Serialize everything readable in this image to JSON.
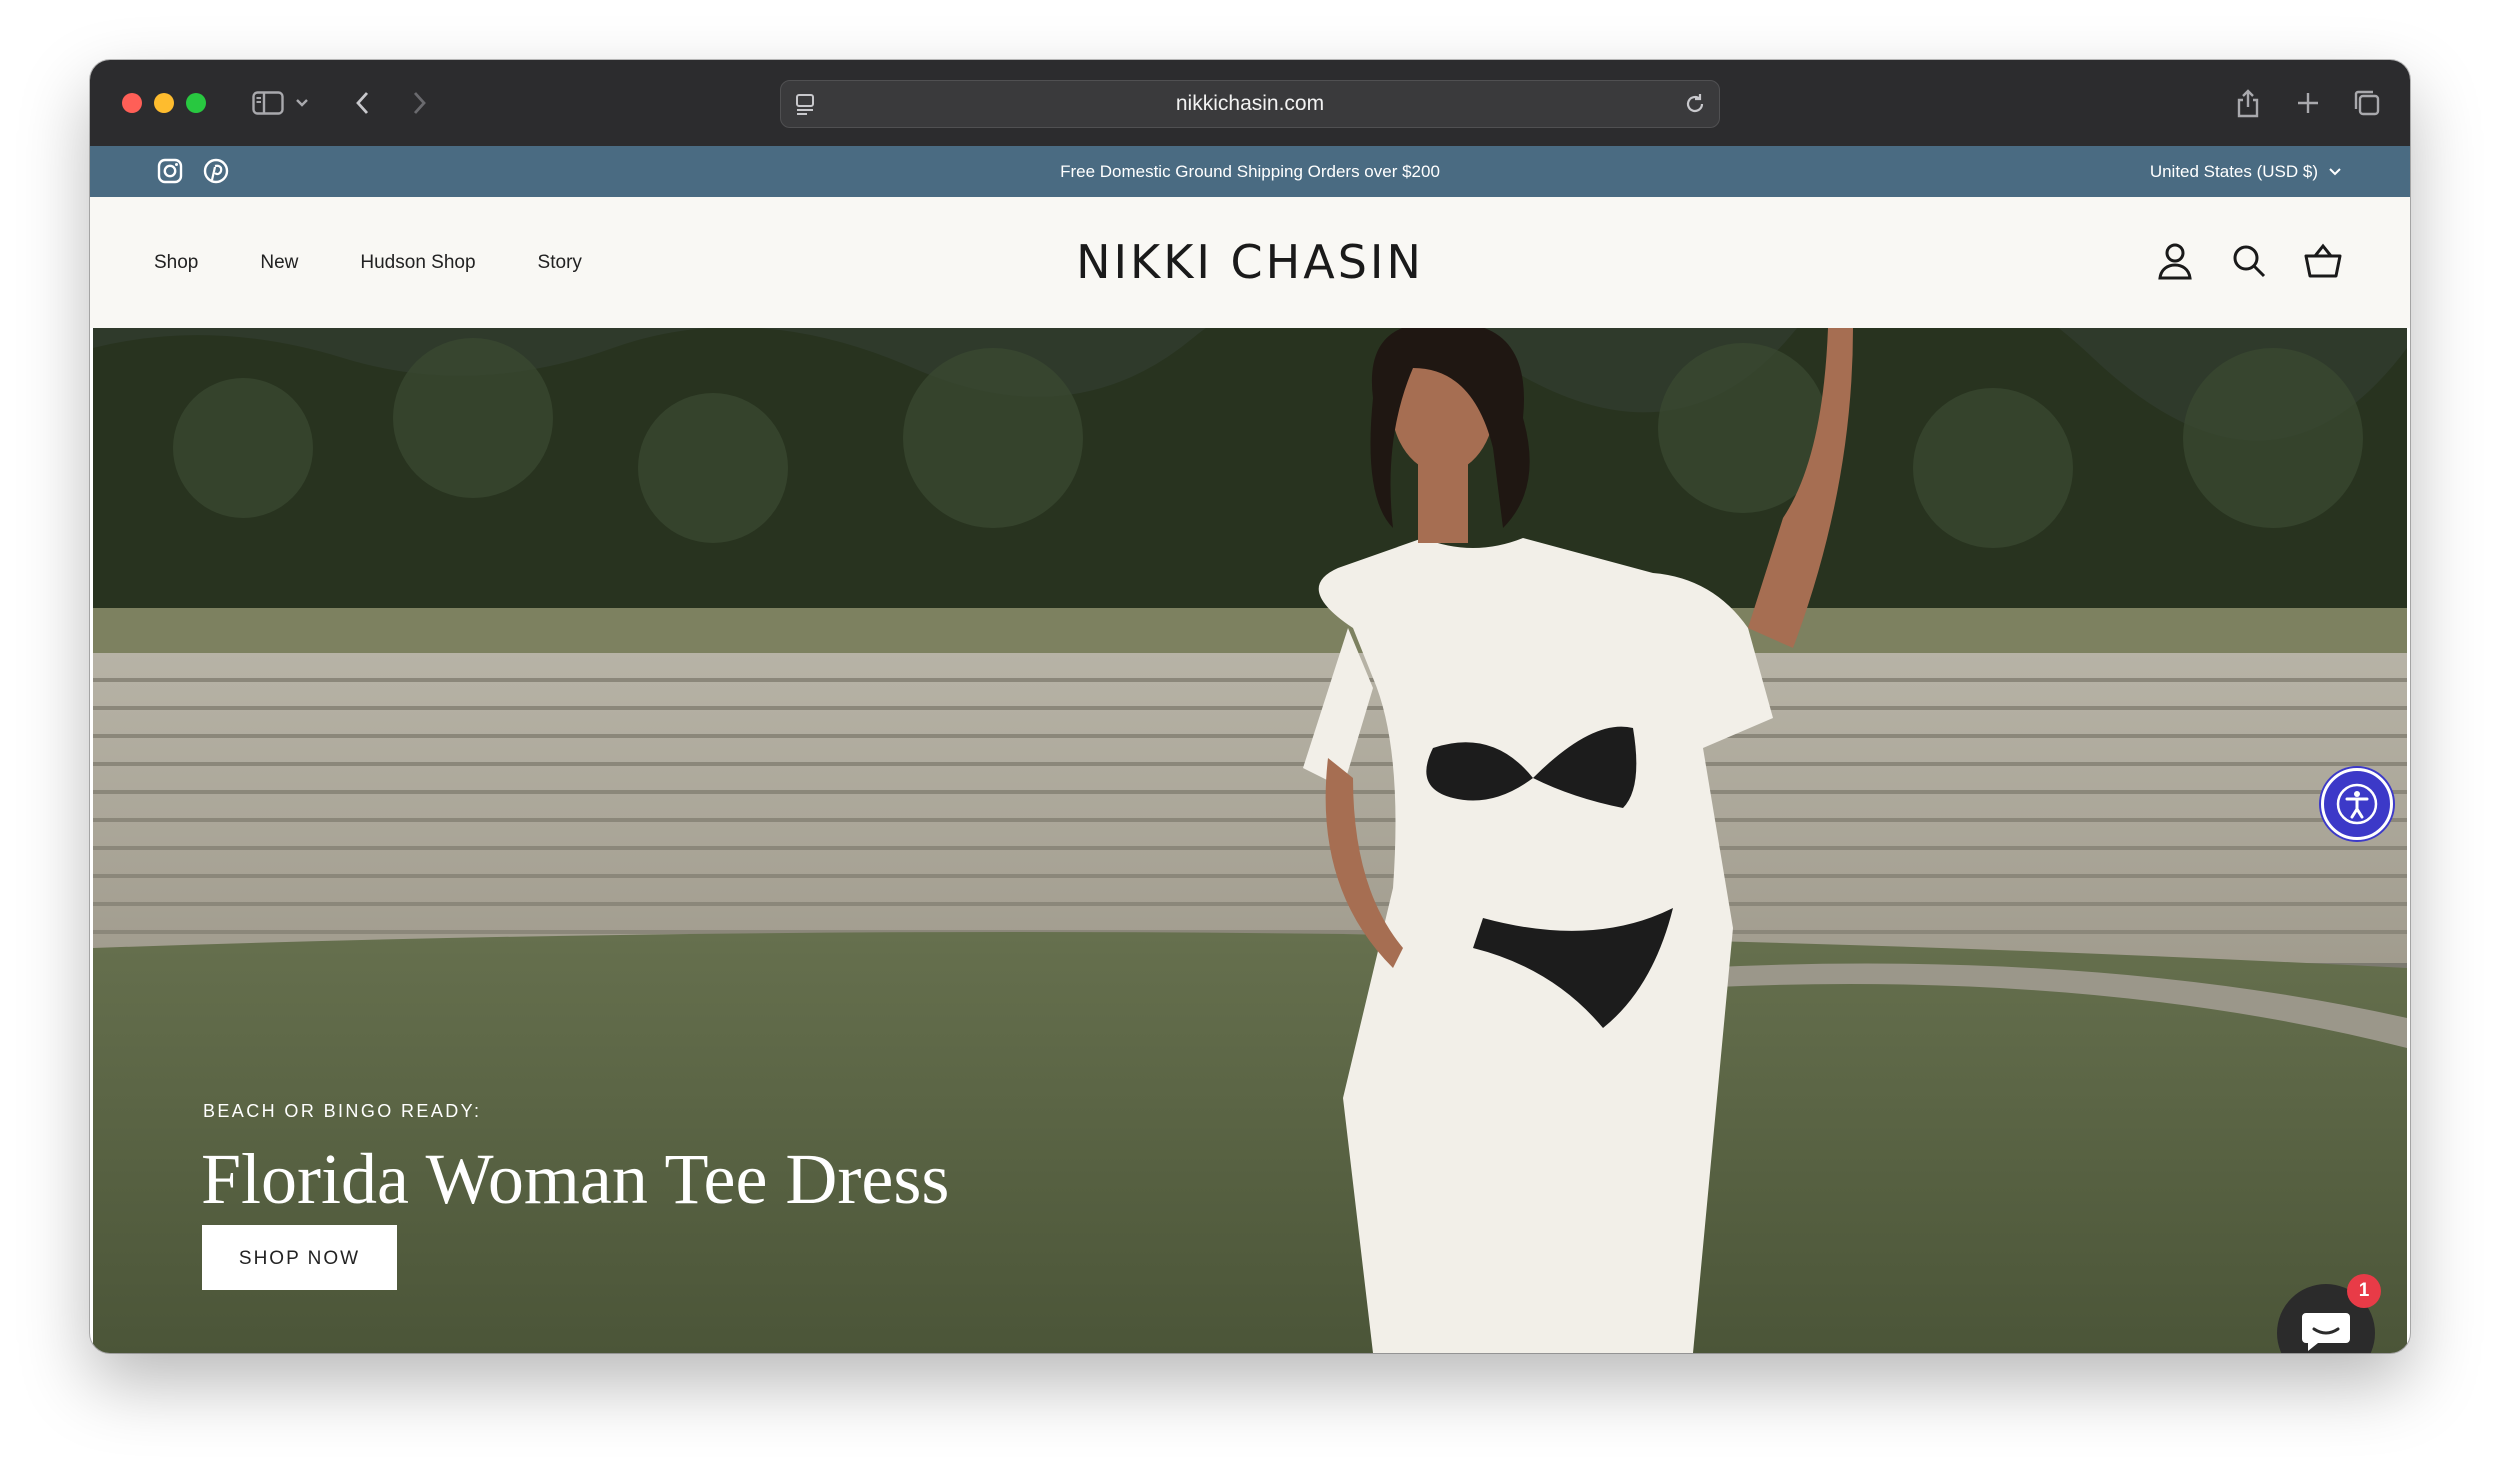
{
  "browser": {
    "url": "nikkichasin.com",
    "icons": [
      "sidebar-icon",
      "chevron-down-icon",
      "back-icon",
      "forward-icon",
      "page-menu-icon",
      "reload-icon",
      "share-icon",
      "new-tab-icon",
      "tabs-overview-icon"
    ]
  },
  "announcement": {
    "message": "Free Domestic Ground Shipping Orders over $200",
    "currency": "United States (USD $)",
    "social_icons": [
      "instagram-icon",
      "pinterest-icon"
    ],
    "background": "#4a6b82"
  },
  "header": {
    "nav": [
      "Shop",
      "New",
      "Hudson Shop",
      "Story"
    ],
    "logo": "NIKKI CHASIN",
    "icons": [
      "account-icon",
      "search-icon",
      "cart-icon"
    ],
    "background": "#f9f8f4"
  },
  "hero": {
    "eyebrow": "BEACH OR BINGO READY:",
    "title": "Florida Woman Tee Dress",
    "cta": "SHOP NOW"
  },
  "widgets": {
    "accessibility_icon": "accessibility-icon",
    "chat_icon": "chat-icon",
    "chat_badge": "1"
  }
}
